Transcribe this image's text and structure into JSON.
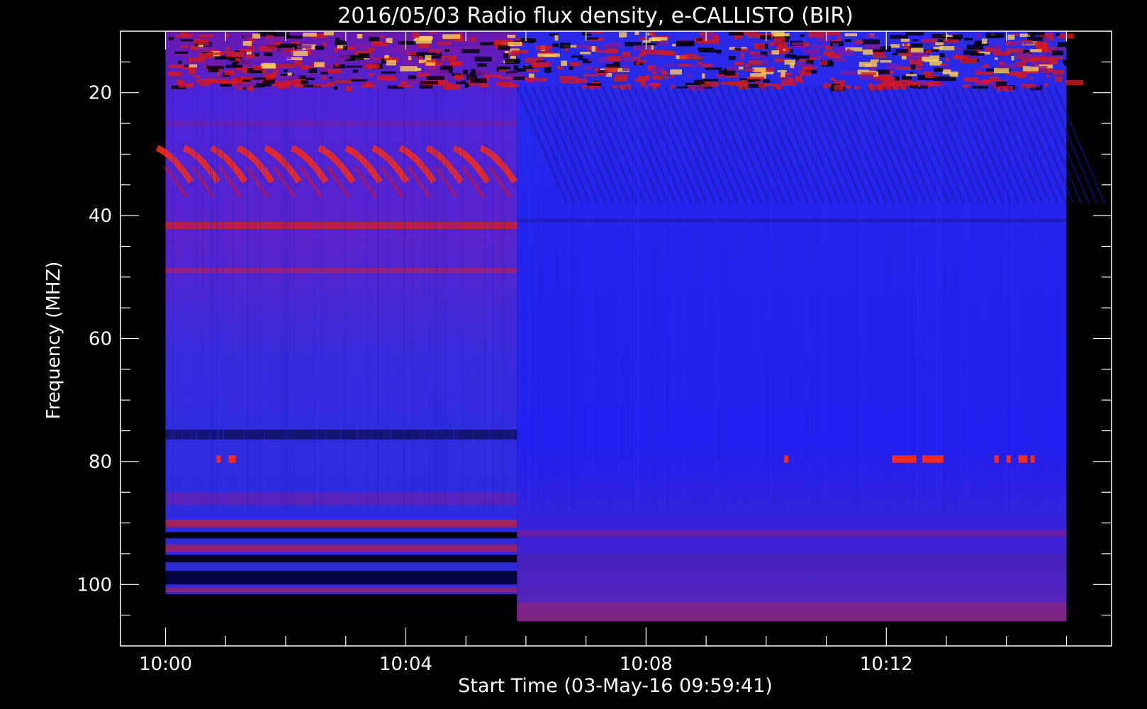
{
  "chart_data": {
    "type": "heatmap",
    "title": "2016/05/03  Radio flux density, e-CALLISTO (BIR)",
    "xlabel": "Start Time (03-May-16 09:59:41)",
    "ylabel": "Frequency (MHZ)",
    "x_ticks": [
      {
        "label": "10:00",
        "minute": 0
      },
      {
        "label": "10:04",
        "minute": 4
      },
      {
        "label": "10:08",
        "minute": 8
      },
      {
        "label": "10:12",
        "minute": 12
      }
    ],
    "y_ticks": [
      {
        "label": "20",
        "value": 20
      },
      {
        "label": "40",
        "value": 40
      },
      {
        "label": "60",
        "value": 60
      },
      {
        "label": "80",
        "value": 80
      },
      {
        "label": "100",
        "value": 100
      }
    ],
    "y_minor_step": 5,
    "x_minor_step": 1,
    "axis_range_minutes": [
      -0.75,
      15.75
    ],
    "ylim": [
      10,
      110
    ],
    "y_reversed": true,
    "data_extent": {
      "t_start": 0,
      "t_end": 15,
      "f_top": 10,
      "f_bottom": 106
    },
    "instrument_switch_minute": 5.85,
    "colors": {
      "background": "#000000",
      "low": "#000000",
      "mid": "#1e1ee6",
      "high": "#d01010",
      "peak": "#ffe060",
      "axis": "#ffffff"
    }
  }
}
